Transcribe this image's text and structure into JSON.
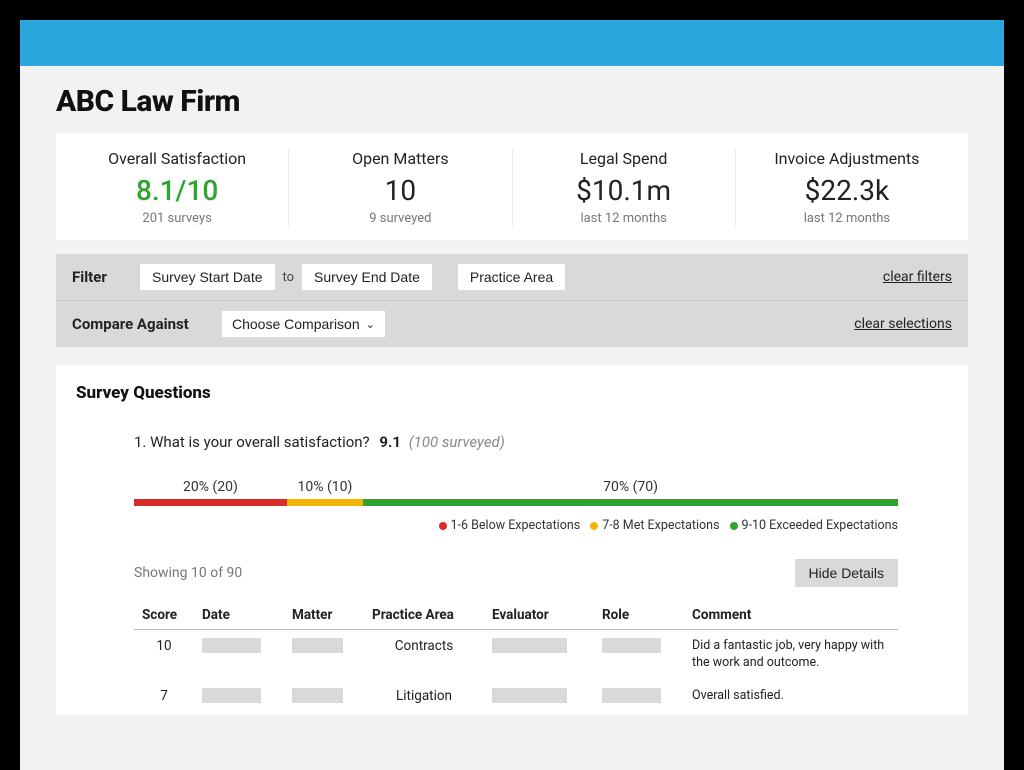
{
  "page_title": "ABC Law Firm",
  "metrics": [
    {
      "label": "Overall Satisfaction",
      "value": "8.1/10",
      "sub": "201 surveys",
      "green": true
    },
    {
      "label": "Open Matters",
      "value": "10",
      "sub": "9 surveyed",
      "green": false
    },
    {
      "label": "Legal Spend",
      "value": "$10.1m",
      "sub": "last 12 months",
      "green": false
    },
    {
      "label": "Invoice Adjustments",
      "value": "$22.3k",
      "sub": "last 12 months",
      "green": false
    }
  ],
  "filter": {
    "label": "Filter",
    "start_date": "Survey Start Date",
    "to": "to",
    "end_date": "Survey End Date",
    "practice_area": "Practice Area",
    "clear": "clear filters"
  },
  "compare": {
    "label": "Compare Against",
    "choose": "Choose Comparison",
    "clear": "clear selections"
  },
  "survey": {
    "heading": "Survey Questions",
    "question_number": "1.",
    "question_text": "What is your overall satisfaction?",
    "score": "9.1",
    "surveyed": "(100 surveyed)",
    "legend": {
      "red": "1-6 Below Expectations",
      "yellow": "7-8 Met Expectations",
      "green": "9-10 Exceeded Expectations"
    },
    "showing": "Showing 10 of 90",
    "hide_details": "Hide Details",
    "columns": {
      "score": "Score",
      "date": "Date",
      "matter": "Matter",
      "practice": "Practice Area",
      "evaluator": "Evaluator",
      "role": "Role",
      "comment": "Comment"
    },
    "rows": [
      {
        "score": "10",
        "practice": "Contracts",
        "comment": "Did a fantastic job, very happy with the work and outcome."
      },
      {
        "score": "7",
        "practice": "Litigation",
        "comment": "Overall satisfied."
      }
    ]
  },
  "chart_data": {
    "type": "bar",
    "title": "Overall satisfaction distribution",
    "categories": [
      "1-6 Below Expectations",
      "7-8 Met Expectations",
      "9-10 Exceeded Expectations"
    ],
    "series": [
      {
        "name": "percent",
        "values": [
          20,
          10,
          70
        ]
      },
      {
        "name": "count",
        "values": [
          20,
          10,
          70
        ]
      }
    ],
    "labels": [
      "20% (20)",
      "10% (10)",
      "70% (70)"
    ],
    "colors": [
      "#d92b2b",
      "#f2b705",
      "#2fa52f"
    ],
    "xlabel": "",
    "ylabel": "",
    "ylim": [
      0,
      100
    ]
  }
}
